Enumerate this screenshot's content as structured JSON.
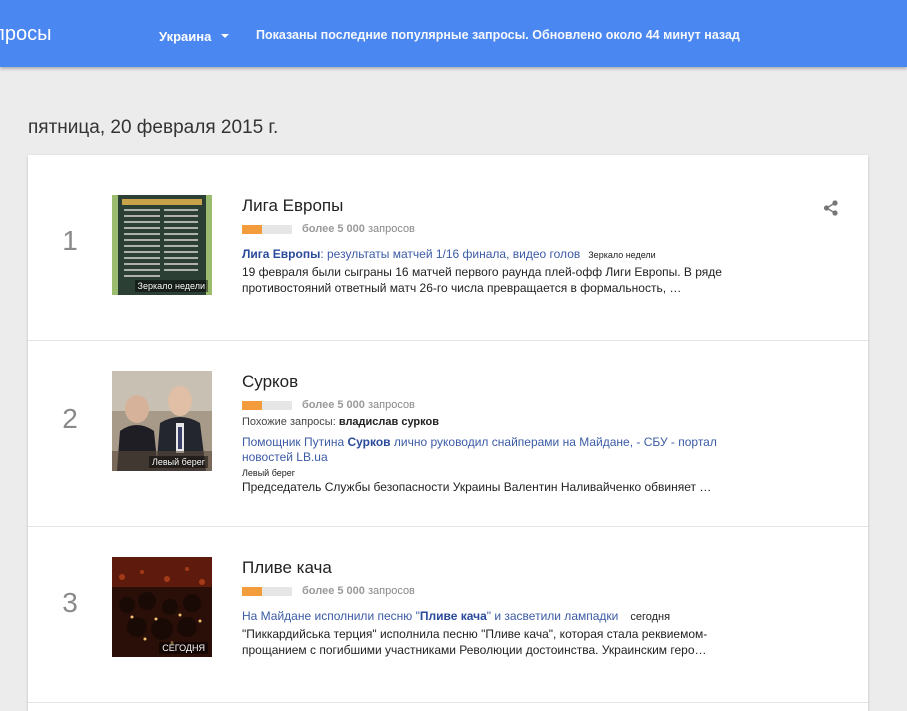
{
  "header": {
    "title": "просы",
    "region": "Украина",
    "status": "Показаны последние популярные запросы. Обновлено около 44 минут назад"
  },
  "date": "пятница, 20 февраля 2015 г.",
  "colors": {
    "brand": "#4b87f0",
    "volume": "#f39c3c",
    "link": "#3b5ba5"
  },
  "items": [
    {
      "rank": "1",
      "title": "Лига Европы",
      "volume_bold": "более 5 000",
      "volume_suffix": " запросов",
      "volume_level": 0.4,
      "thumb_source": "Зеркало недели",
      "article_bold": "Лига Европы",
      "article_rest": ": результаты матчей 1/16 финала, видео голов",
      "article_source": "Зеркало недели",
      "snippet": "19 февраля были сыграны 16 матчей первого раунда плей-офф Лиги Европы. В ряде противостояний ответный матч 26-го числа превращается в формальность, …"
    },
    {
      "rank": "2",
      "title": "Сурков",
      "volume_bold": "более 5 000",
      "volume_suffix": " запросов",
      "volume_level": 0.4,
      "thumb_source": "Левый берег",
      "related_label": "Похожие запросы: ",
      "related_value": "владислав сурков",
      "article_pre": "Помощник Путина ",
      "article_bold": "Сурков",
      "article_rest": " лично руководил снайперами на Майдане, - СБУ - портал новостей LB.ua",
      "article_source": "Левый берег",
      "snippet": "Председатель Службы безопасности Украины Валентин Наливайченко обвиняет …"
    },
    {
      "rank": "3",
      "title": "Пливе кача",
      "volume_bold": "более 5 000",
      "volume_suffix": " запросов",
      "volume_level": 0.4,
      "thumb_source": "СЕГОДНЯ",
      "article_pre": "На Майдане исполнили песню \"",
      "article_bold": "Пливе кача",
      "article_rest": "\" и засветили лампадки",
      "article_source": "сегодня",
      "snippet": "\"Пиккардийська терция\" исполнила песню \"Пливе кача\", которая стала реквиемом-прощанием с погибшими участниками Революции достоинства. Украинским геро…"
    }
  ],
  "icons": {
    "share": "share-icon",
    "region_toggle": "chevron-down-icon"
  }
}
